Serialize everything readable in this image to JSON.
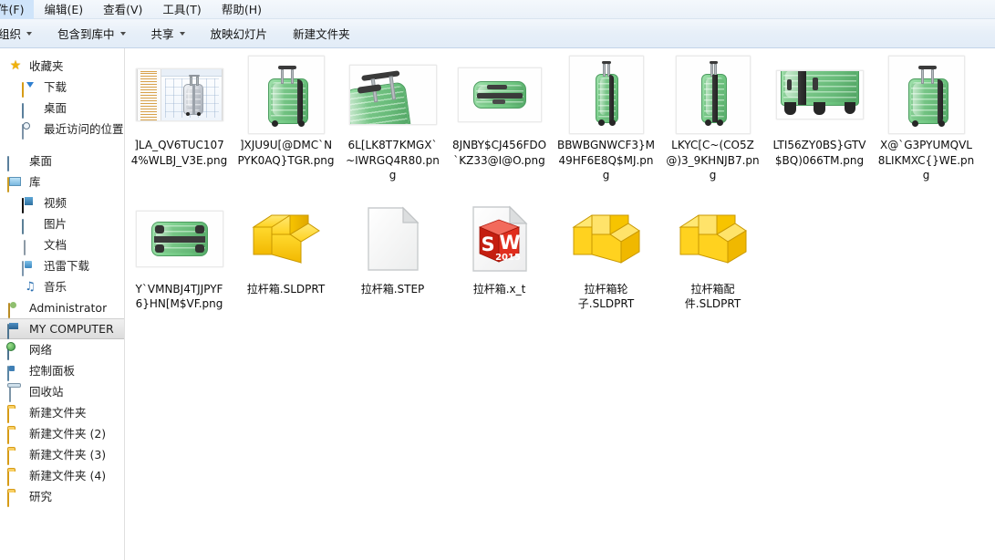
{
  "window": {
    "menu": [
      {
        "label": "件(F)",
        "name": "menu-file"
      },
      {
        "label": "编辑(E)",
        "name": "menu-edit"
      },
      {
        "label": "查看(V)",
        "name": "menu-view"
      },
      {
        "label": "工具(T)",
        "name": "menu-tools"
      },
      {
        "label": "帮助(H)",
        "name": "menu-help"
      }
    ],
    "toolbar": [
      {
        "label": "组织",
        "caret": true,
        "name": "toolbar-organize"
      },
      {
        "label": "包含到库中",
        "caret": true,
        "name": "toolbar-include-in-library"
      },
      {
        "label": "共享",
        "caret": true,
        "name": "toolbar-share"
      },
      {
        "label": "放映幻灯片",
        "caret": false,
        "name": "toolbar-slideshow"
      },
      {
        "label": "新建文件夹",
        "caret": false,
        "name": "toolbar-new-folder"
      }
    ]
  },
  "sidebar": {
    "selected": "MY COMPUTER",
    "groups": [
      {
        "items": [
          {
            "label": "收藏夹",
            "icon": "star-icon",
            "indent": 0
          },
          {
            "label": "下载",
            "icon": "downloads-folder-icon",
            "indent": 1
          },
          {
            "label": "桌面",
            "icon": "desktop-icon",
            "indent": 1
          },
          {
            "label": "最近访问的位置",
            "icon": "recent-places-icon",
            "indent": 1
          }
        ]
      },
      {
        "items": [
          {
            "label": "桌面",
            "icon": "desktop-icon",
            "indent": 0
          },
          {
            "label": "库",
            "icon": "library-icon",
            "indent": 0
          },
          {
            "label": "视频",
            "icon": "videos-icon",
            "indent": 1
          },
          {
            "label": "图片",
            "icon": "pictures-icon",
            "indent": 1
          },
          {
            "label": "文档",
            "icon": "documents-icon",
            "indent": 1
          },
          {
            "label": "迅雷下载",
            "icon": "xunlei-download-icon",
            "indent": 1
          },
          {
            "label": "音乐",
            "icon": "music-icon",
            "indent": 1
          },
          {
            "label": "Administrator",
            "icon": "user-icon",
            "indent": 0
          },
          {
            "label": "MY COMPUTER",
            "icon": "computer-icon",
            "indent": 0
          },
          {
            "label": "网络",
            "icon": "network-icon",
            "indent": 0
          },
          {
            "label": "控制面板",
            "icon": "control-panel-icon",
            "indent": 0
          },
          {
            "label": "回收站",
            "icon": "recycle-bin-icon",
            "indent": 0
          },
          {
            "label": "新建文件夹",
            "icon": "folder-icon",
            "indent": 0
          },
          {
            "label": "新建文件夹 (2)",
            "icon": "folder-icon",
            "indent": 0
          },
          {
            "label": "新建文件夹 (3)",
            "icon": "folder-icon",
            "indent": 0
          },
          {
            "label": "新建文件夹 (4)",
            "icon": "folder-icon",
            "indent": 0
          },
          {
            "label": "研究",
            "icon": "folder-icon",
            "indent": 0
          }
        ]
      }
    ]
  },
  "files": {
    "row1": [
      {
        "name": "]LA_QV6TUC1074%WLBJ_V3E.png",
        "thumb": "cad-screenshot"
      },
      {
        "name": "]XJU9U[@DMC`NPYK0AQ}TGR.png",
        "thumb": "suitcase-front-3q"
      },
      {
        "name": "6L[LK8T7KMGX`~IWRGQ4R80.png",
        "thumb": "suitcase-handle-closeup"
      },
      {
        "name": "8JNBY$CJ456FDO`KZ33@I@O.png",
        "thumb": "suitcase-top-view"
      },
      {
        "name": "BBWBGNWCF3}M49HF6E8Q$MJ.png",
        "thumb": "suitcase-side-tall"
      },
      {
        "name": "LKYC[C~(CO5Z@)3_9KHNJB7.png",
        "thumb": "suitcase-back-tall"
      },
      {
        "name": "LTI56ZY0BS}GTV$BQ)066TM.png",
        "thumb": "suitcase-bottom-closeup"
      },
      {
        "name": "X@`G3PYUMQVL8LIKMXC{}WE.png",
        "thumb": "suitcase-front-3q"
      }
    ],
    "row2": [
      {
        "name": "Y`VMNBJ4TJJPYF6}HN[M$VF.png",
        "thumb": "suitcase-lying-view"
      },
      {
        "name": "拉杆箱.SLDPRT",
        "thumb": "sldprt-icon"
      },
      {
        "name": "拉杆箱.STEP",
        "thumb": "generic-file-icon"
      },
      {
        "name": "拉杆箱.x_t",
        "thumb": "solidworks-xt-icon"
      },
      {
        "name": "拉杆箱轮子.SLDPRT",
        "thumb": "sldprt-icon"
      },
      {
        "name": "拉杆箱配件.SLDPRT",
        "thumb": "sldprt-icon"
      }
    ]
  },
  "colors": {
    "suitcase_green": "#7fd18f",
    "sldprt_yellow": "#ffd400",
    "sw_red": "#d92b1e",
    "selection_gray": "#dcdcdc"
  }
}
